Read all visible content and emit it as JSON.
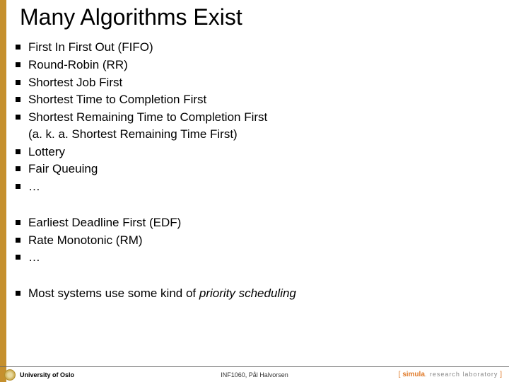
{
  "title": "Many Algorithms Exist",
  "groups": [
    [
      {
        "text": "First In First Out (FIFO)"
      },
      {
        "text": "Round-Robin (RR)"
      },
      {
        "text": "Shortest Job First"
      },
      {
        "text": "Shortest Time to Completion First"
      },
      {
        "text": "Shortest Remaining Time to Completion First",
        "sub": "(a. k. a. Shortest Remaining Time First)"
      },
      {
        "text": "Lottery"
      },
      {
        "text": "Fair Queuing"
      },
      {
        "text": "…"
      }
    ],
    [
      {
        "text": "Earliest Deadline First (EDF)"
      },
      {
        "text": "Rate Monotonic (RM)"
      },
      {
        "text": "…"
      }
    ],
    [
      {
        "text_pre": "Most systems use some kind of ",
        "text_italic": "priority scheduling"
      }
    ]
  ],
  "footer": {
    "university": "University of Oslo",
    "course": "INF1060, Pål Halvorsen",
    "logo_brand": "simula",
    "logo_rest": ". research laboratory"
  }
}
